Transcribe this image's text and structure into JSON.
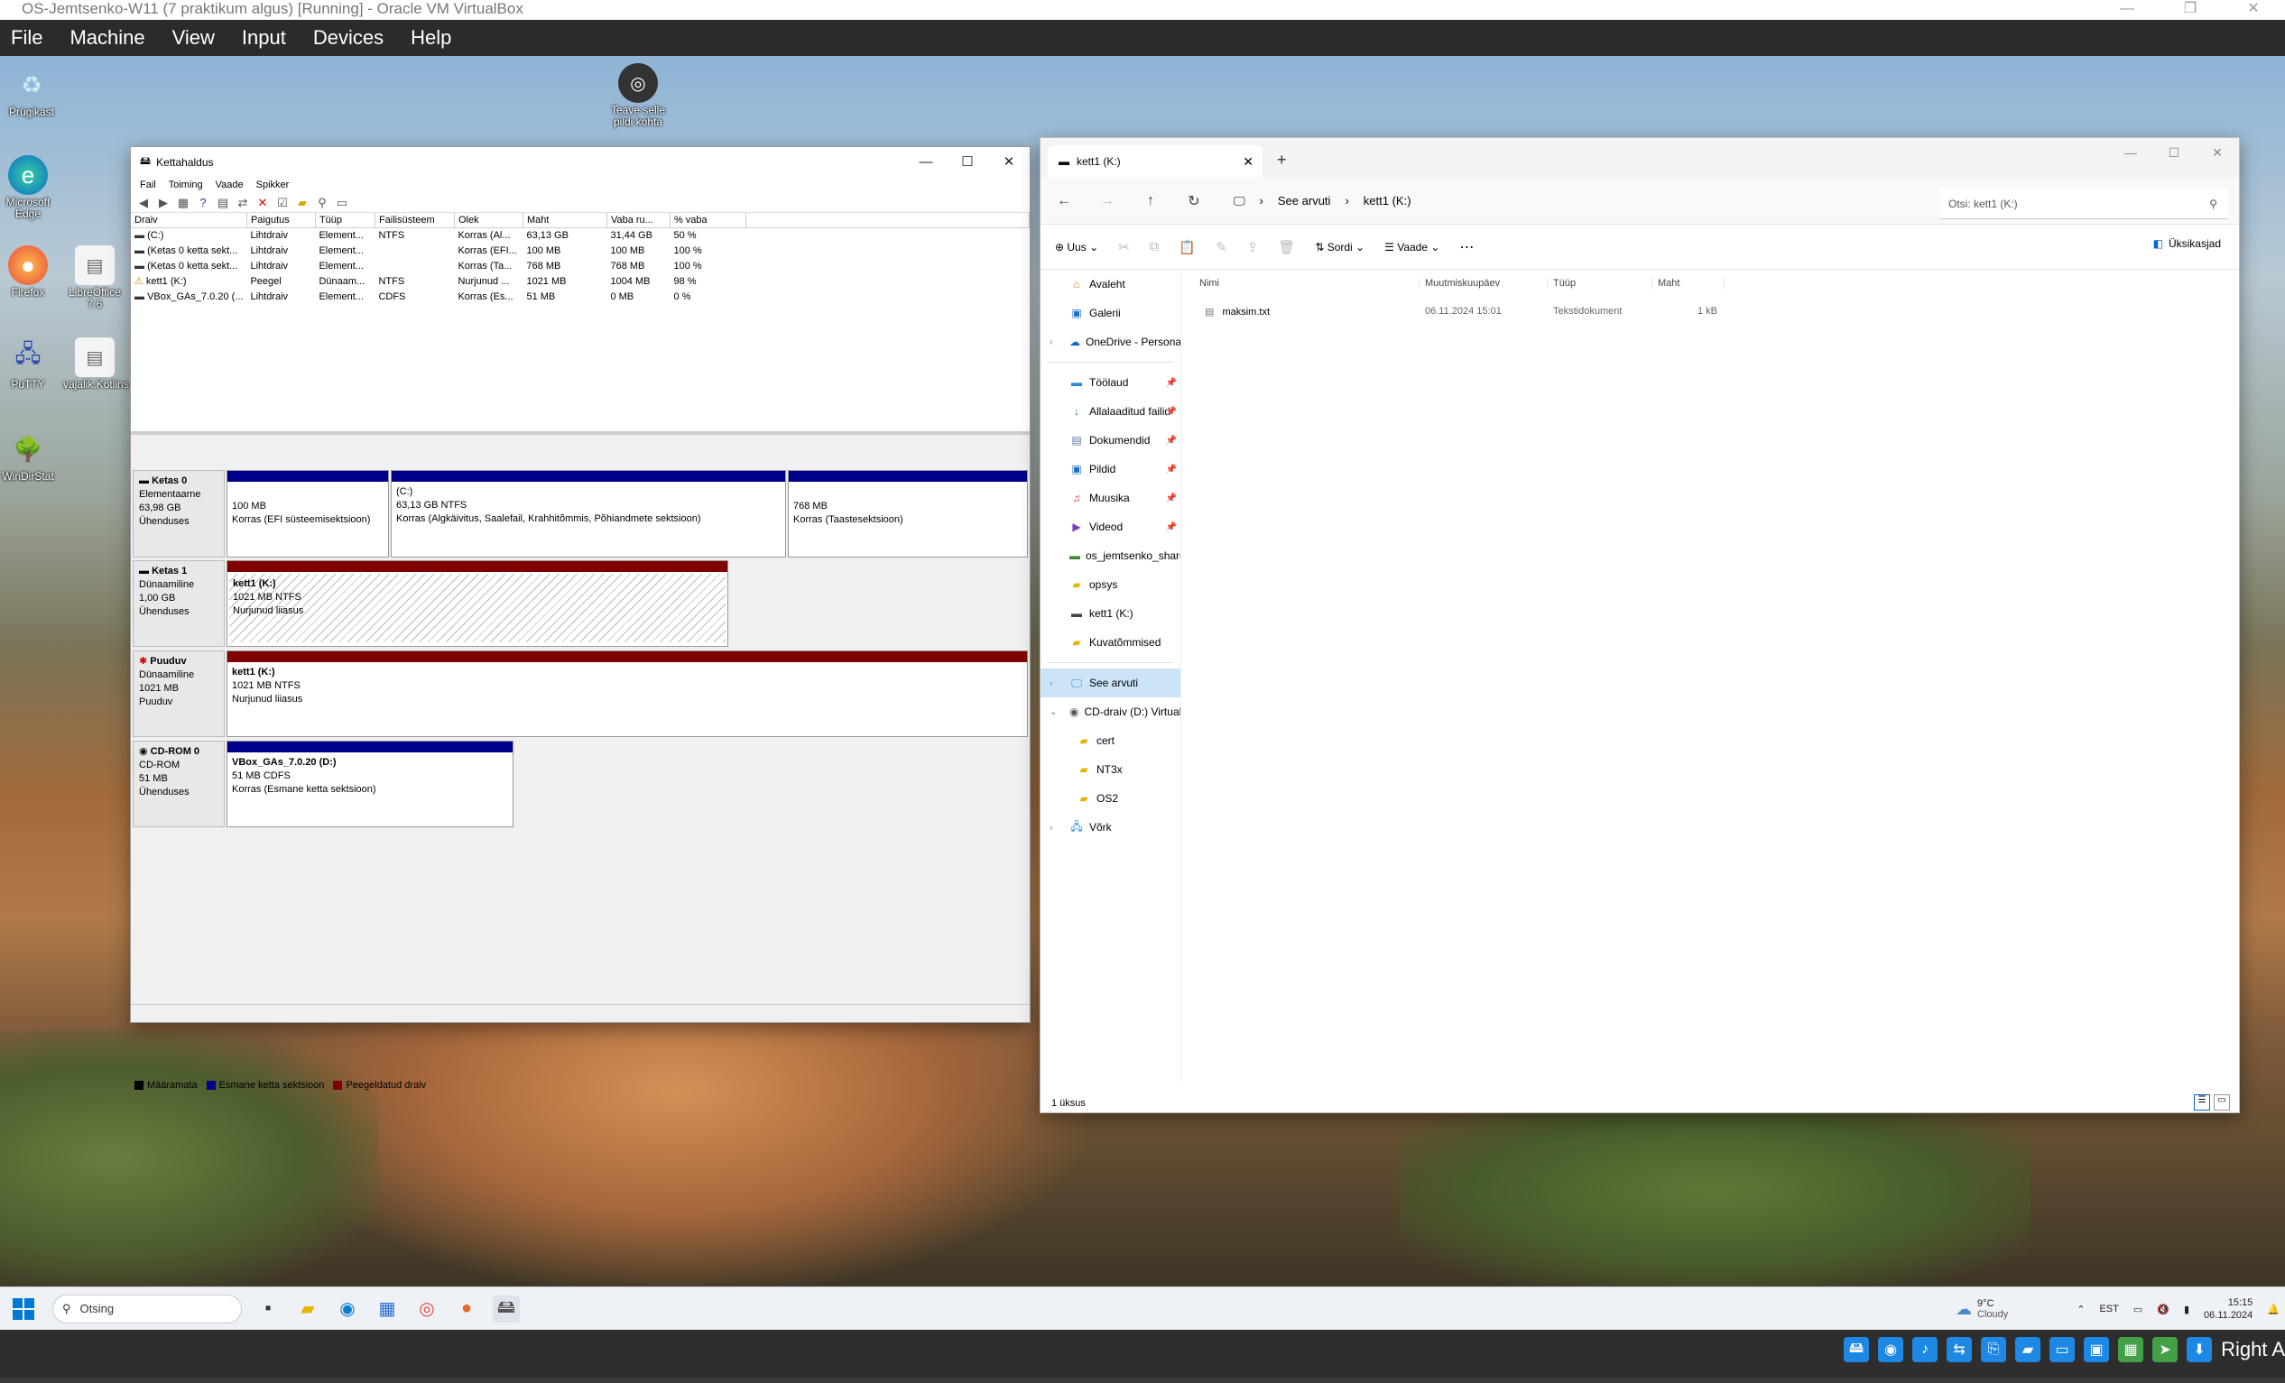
{
  "vbox": {
    "title": "OS-Jemtsenko-W11 (7 praktikum algus) [Running] - Oracle VM VirtualBox",
    "menu": [
      "File",
      "Machine",
      "View",
      "Input",
      "Devices",
      "Help"
    ],
    "host_key": "Right A"
  },
  "desktop_icons": [
    "Prügikast",
    "Microsoft Edge",
    "Firefox",
    "LibreOffice 7.6",
    "PuTTY",
    "vajalik.Kotlins",
    "WinDirStat",
    "Teave selle pildi kohta"
  ],
  "disk_mgmt": {
    "title": "Kettahaldus",
    "menu": [
      "Fail",
      "Toiming",
      "Vaade",
      "Spikker"
    ],
    "columns": [
      "Draiv",
      "Paigutus",
      "Tüüp",
      "Failisüsteem",
      "Olek",
      "Maht",
      "Vaba ru...",
      "% vaba"
    ],
    "rows": [
      [
        "(C:)",
        "Lihtdraiv",
        "Element...",
        "NTFS",
        "Korras (Al...",
        "63,13 GB",
        "31,44 GB",
        "50 %"
      ],
      [
        "(Ketas 0 ketta sekt...",
        "Lihtdraiv",
        "Element...",
        "",
        "Korras (EFI...",
        "100 MB",
        "100 MB",
        "100 %"
      ],
      [
        "(Ketas 0 ketta sekt...",
        "Lihtdraiv",
        "Element...",
        "",
        "Korras (Ta...",
        "768 MB",
        "768 MB",
        "100 %"
      ],
      [
        "kett1 (K:)",
        "Peegel",
        "Dünaam...",
        "NTFS",
        "Nurjunud ...",
        "1021 MB",
        "1004 MB",
        "98 %"
      ],
      [
        "VBox_GAs_7.0.20 (...",
        "Lihtdraiv",
        "Element...",
        "CDFS",
        "Korras (Es...",
        "51 MB",
        "0 MB",
        "0 %"
      ]
    ],
    "disks": {
      "d0": {
        "name": "Ketas 0",
        "type": "Elementaarne",
        "size": "63,98 GB",
        "status": "Ühenduses",
        "p1": {
          "l1": "100 MB",
          "l2": "Korras (EFI süsteemisektsioon)"
        },
        "p2": {
          "title": "(C:)",
          "l1": "63,13 GB NTFS",
          "l2": "Korras (Algkäivitus, Saalefail, Krahhitõmmis, Põhiandmete sektsioon)"
        },
        "p3": {
          "l1": "768 MB",
          "l2": "Korras (Taastesektsioon)"
        }
      },
      "d1": {
        "name": "Ketas 1",
        "type": "Dünaamiline",
        "size": "1,00 GB",
        "status": "Ühenduses",
        "p1": {
          "title": "kett1  (K:)",
          "l1": "1021 MB NTFS",
          "l2": "Nurjunud liiasus"
        }
      },
      "d2": {
        "name": "Puuduv",
        "type": "Dünaamiline",
        "size": "1021 MB",
        "status": "Puuduv",
        "p1": {
          "title": "kett1  (K:)",
          "l1": "1021 MB NTFS",
          "l2": "Nurjunud liiasus"
        }
      },
      "d3": {
        "name": "CD-ROM 0",
        "type": "CD-ROM",
        "size": "51 MB",
        "status": "Ühenduses",
        "p1": {
          "title": "VBox_GAs_7.0.20  (D:)",
          "l1": "51 MB CDFS",
          "l2": "Korras (Esmane ketta sektsioon)"
        }
      }
    },
    "legend": [
      "Määramata",
      "Esmane ketta sektsioon",
      "Peegeldatud draiv"
    ],
    "legend_colors": [
      "#000000",
      "#00008b",
      "#800000"
    ]
  },
  "explorer": {
    "tab_title": "kett1 (K:)",
    "breadcrumb": [
      "See arvuti",
      "kett1 (K:)"
    ],
    "search_placeholder": "Otsi: kett1 (K:)",
    "cmd": {
      "new": "Uus",
      "sort": "Sordi",
      "view": "Vaade",
      "details": "Üksikasjad"
    },
    "nav": {
      "home": "Avaleht",
      "gallery": "Galerii",
      "onedrive": "OneDrive - Persona",
      "desktop": "Töölaud",
      "downloads": "Allalaaditud failid",
      "documents": "Dokumendid",
      "pictures": "Pildid",
      "music": "Muusika",
      "videos": "Videod",
      "share": "os_jemtsenko_share",
      "opsys": "opsys",
      "kett1": "kett1 (K:)",
      "screens": "Kuvatõmmised",
      "thispc": "See arvuti",
      "cd": "CD-draiv (D:) Virtual",
      "cert": "cert",
      "nt3x": "NT3x",
      "os2": "OS2",
      "network": "Võrk"
    },
    "columns": {
      "name": "Nimi",
      "modified": "Muutmiskuupäev",
      "type": "Tüüp",
      "size": "Maht"
    },
    "file": {
      "name": "maksim.txt",
      "modified": "06.11.2024 15:01",
      "type": "Tekstidokument",
      "size": "1 kB"
    },
    "status": "1 üksus"
  },
  "taskbar": {
    "search": "Otsing",
    "temp": "9°C",
    "weather": "Cloudy",
    "lang": "EST",
    "time": "15:15",
    "date": "06.11.2024"
  }
}
